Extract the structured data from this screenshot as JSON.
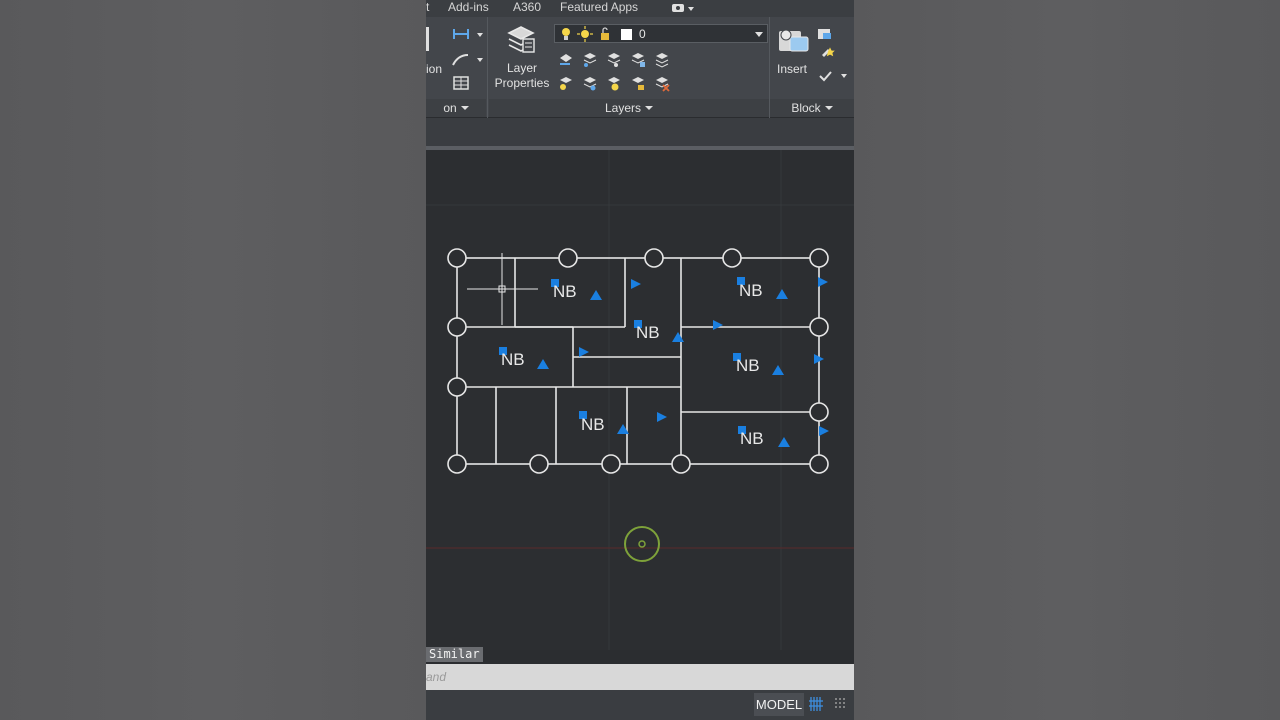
{
  "tabs": [
    "t",
    "Add-ins",
    "A360",
    "Featured Apps"
  ],
  "ribbon": {
    "partial_label": "ion",
    "layer_properties_line1": "Layer",
    "layer_properties_line2": "Properties",
    "current_layer": "0",
    "insert_label": "Insert",
    "panels": {
      "left_partial": "on",
      "layers": "Layers",
      "block": "Block"
    }
  },
  "plan": {
    "room_tags": [
      "NB",
      "NB",
      "NB",
      "NB",
      "NB",
      "NB",
      "NB"
    ]
  },
  "command": {
    "selection_hint": "Similar",
    "input_placeholder": "and"
  },
  "status": {
    "model": "MODEL"
  },
  "colors": {
    "accent_blue": "#1a7fe0",
    "line": "#e6e6e6",
    "ucs_green": "#7ea23a"
  }
}
